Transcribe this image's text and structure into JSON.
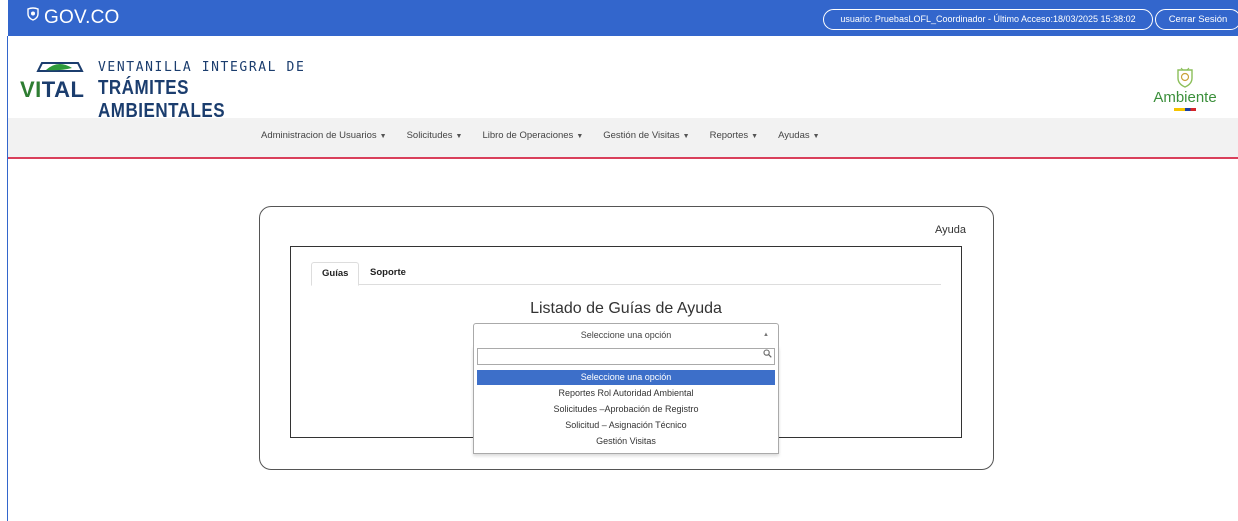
{
  "gov_bar": {
    "logo": "GOV.CO",
    "user_info": "usuario: PruebasLOFL_Coordinador - Último Acceso:18/03/2025 15:38:02",
    "logout_label": "Cerrar Sesión",
    "color": "#3366cc"
  },
  "brand": {
    "vital_part1": "VI",
    "vital_part2": "TAL",
    "line1": "VENTANILLA INTEGRAL DE",
    "line2": "TRÁMITES AMBIENTALES",
    "ministry": "Ambiente"
  },
  "nav": {
    "items": [
      {
        "label": "Administracion de Usuarios"
      },
      {
        "label": "Solicitudes"
      },
      {
        "label": "Libro de Operaciones"
      },
      {
        "label": "Gestión de Visitas"
      },
      {
        "label": "Reportes"
      },
      {
        "label": "Ayudas"
      }
    ],
    "accent": "#d9405b"
  },
  "help_panel": {
    "title": "Ayuda",
    "tabs": [
      {
        "label": "Guías",
        "active": true
      },
      {
        "label": "Soporte",
        "active": false
      }
    ],
    "heading": "Listado de Guías de Ayuda",
    "select": {
      "selected": "Seleccione una opción",
      "search_value": "",
      "options": [
        {
          "label": "Seleccione una opción",
          "highlighted": true
        },
        {
          "label": "Reportes Rol Autoridad Ambiental",
          "highlighted": false
        },
        {
          "label": "Solicitudes –Aprobación de Registro",
          "highlighted": false
        },
        {
          "label": "Solicitud – Asignación Técnico",
          "highlighted": false
        },
        {
          "label": "Gestión Visitas",
          "highlighted": false
        }
      ]
    }
  }
}
